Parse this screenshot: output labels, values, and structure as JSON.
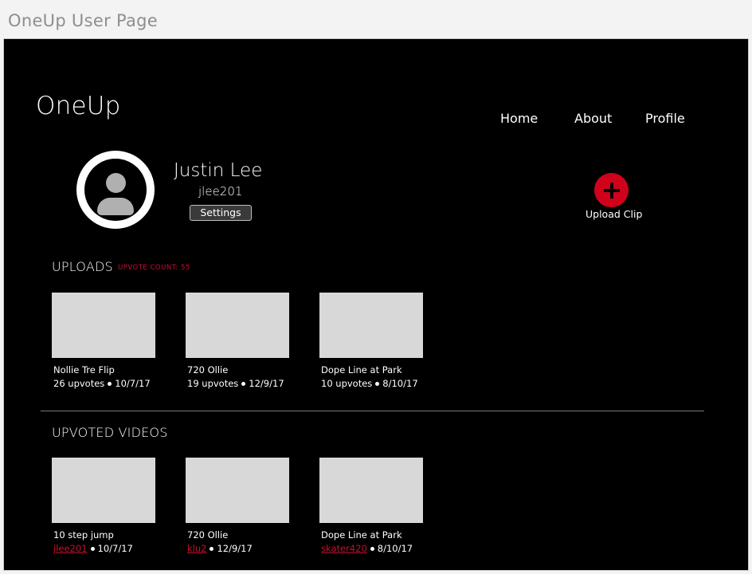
{
  "window": {
    "title": "OneUp User Page"
  },
  "header": {
    "logo": "OneUp",
    "nav": [
      "Home",
      "About",
      "Profile"
    ]
  },
  "profile": {
    "name": "Justin Lee",
    "username": "jlee201",
    "settings_label": "Settings",
    "upload_label": "Upload Clip"
  },
  "uploads": {
    "title": "UPLOADS",
    "upvote_count_label": "UPVOTE COUNT: 55",
    "items": [
      {
        "title": "Nollie Tre Flip",
        "upvotes": "26 upvotes",
        "date": "10/7/17"
      },
      {
        "title": "720 Ollie",
        "upvotes": "19 upvotes",
        "date": "12/9/17"
      },
      {
        "title": "Dope Line at Park",
        "upvotes": "10 upvotes",
        "date": "8/10/17"
      }
    ]
  },
  "upvoted": {
    "title": "UPVOTED VIDEOS",
    "items": [
      {
        "title": "10 step jump",
        "user": "jlee201",
        "date": "10/7/17"
      },
      {
        "title": "720 Ollie",
        "user": "klu2",
        "date": "12/9/17"
      },
      {
        "title": "Dope Line at Park",
        "user": "skater420",
        "date": "8/10/17"
      }
    ]
  },
  "colors": {
    "accent": "#d0021b",
    "background": "#000000",
    "thumbnail": "#d8d8d8"
  },
  "icons": {
    "avatar": "user-avatar-icon",
    "upload": "plus-icon"
  }
}
